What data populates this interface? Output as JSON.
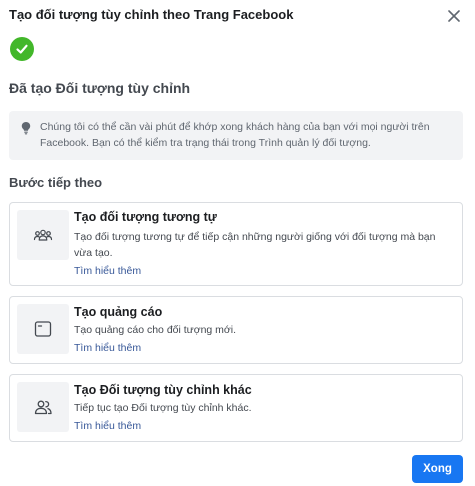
{
  "header": {
    "title": "Tạo đối tượng tùy chỉnh theo Trang Facebook"
  },
  "status": {
    "title": "Đã tạo Đối tượng tùy chỉnh",
    "info": "Chúng tôi có thể cần vài phút để khớp xong khách hàng của bạn với mọi người trên Facebook. Bạn có thể kiểm tra trạng thái trong Trình quản lý đối tượng."
  },
  "next_steps": {
    "title": "Bước tiếp theo",
    "cards": [
      {
        "icon": "people-group-icon",
        "title": "Tạo đối tượng tương tự",
        "description": "Tạo đối tượng tương tự để tiếp cận những người giống với đối tượng mà bạn vừa tạo.",
        "link": "Tìm hiểu thêm"
      },
      {
        "icon": "ad-window-icon",
        "title": "Tạo quảng cáo",
        "description": "Tạo quảng cáo cho đối tượng mới.",
        "link": "Tìm hiểu thêm"
      },
      {
        "icon": "people-pair-icon",
        "title": "Tạo Đối tượng tùy chỉnh khác",
        "description": "Tiếp tục tạo Đối tượng tùy chỉnh khác.",
        "link": "Tìm hiểu thêm"
      }
    ]
  },
  "footer": {
    "done_label": "Xong"
  },
  "colors": {
    "primary": "#1877f2",
    "success": "#42b72a",
    "link": "#385898"
  }
}
